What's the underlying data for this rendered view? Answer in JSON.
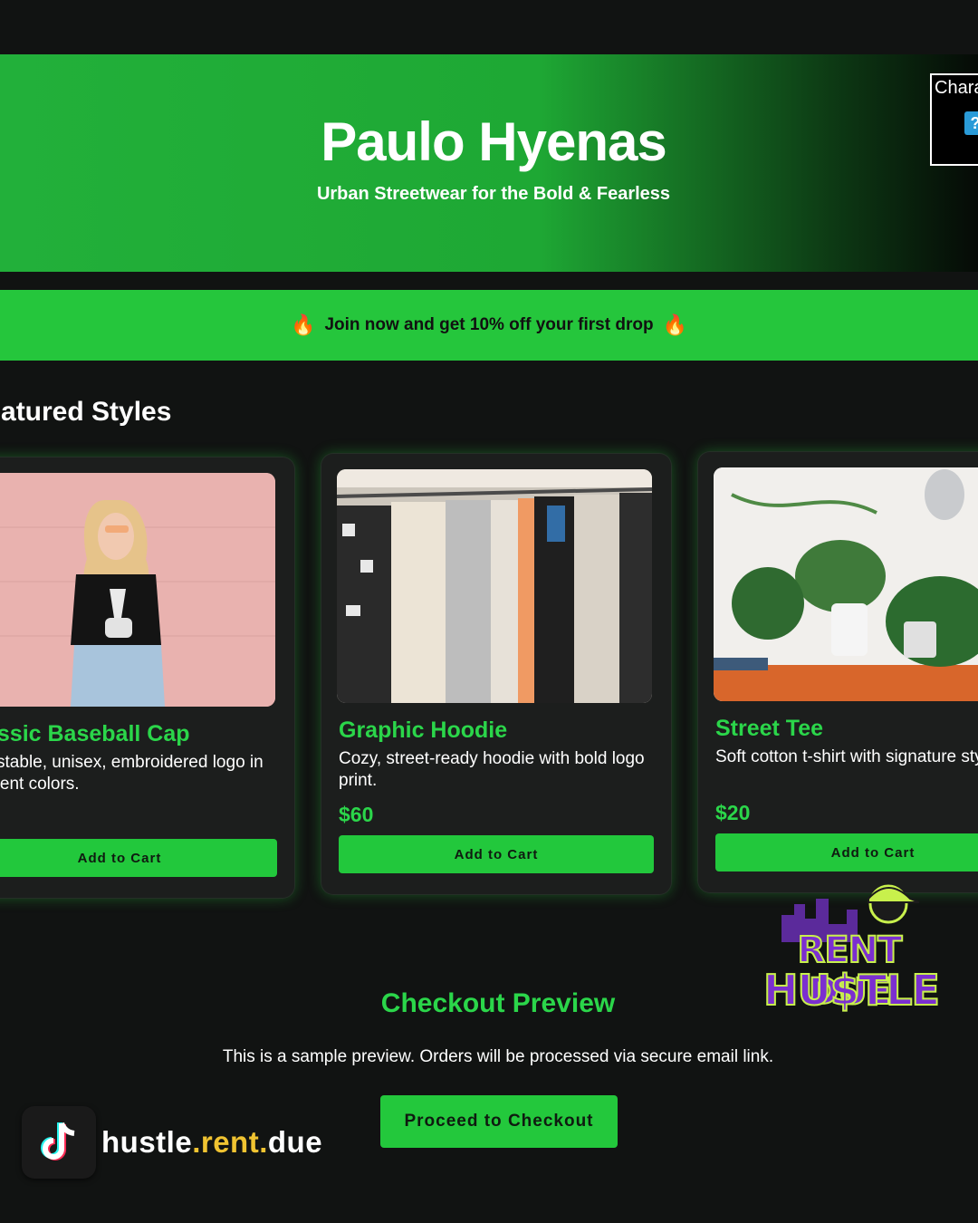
{
  "header": {
    "brand": "Paulo Hyenas",
    "tagline": "Urban Streetwear for the Bold & Fearless"
  },
  "char_widget": {
    "label": "Chara",
    "help": "?"
  },
  "promo": {
    "fire_left": "🔥",
    "text": "Join now and get 10% off your first drop",
    "fire_right": "🔥"
  },
  "featured": {
    "title": "Featured Styles",
    "cards": [
      {
        "name": "Classic Baseball Cap",
        "desc": "Adjustable, unisex, embroidered logo in different colors.",
        "price": "",
        "button": "Add to Cart"
      },
      {
        "name": "Graphic Hoodie",
        "desc": "Cozy, street-ready hoodie with bold logo print.",
        "price": "$60",
        "button": "Add to Cart"
      },
      {
        "name": "Street Tee",
        "desc": "Soft cotton t-shirt with signature style.",
        "price": "$20",
        "button": "Add to Cart"
      }
    ]
  },
  "checkout": {
    "title": "Checkout Preview",
    "note": "This is a sample preview. Orders will be processed via secure email link.",
    "button": "Proceed to Checkout"
  },
  "overlay": {
    "handle_part1": "hustle",
    "handle_dot1": ".",
    "handle_part2": "rent",
    "handle_dot2": ".",
    "handle_part3": "due",
    "badge_line1": "RENT DUE",
    "badge_line2": "HU$TLE"
  },
  "colors": {
    "accent": "#22c83c",
    "accent_text": "#2bd64a",
    "background": "#111312",
    "card": "#1c1e1d"
  }
}
